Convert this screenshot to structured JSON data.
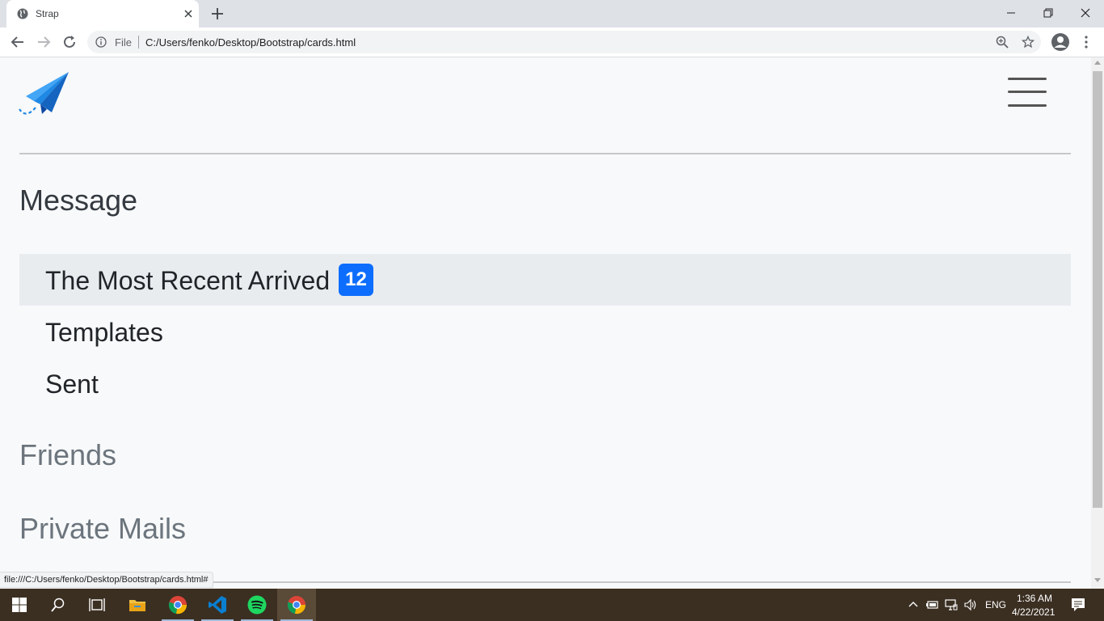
{
  "browser": {
    "tab_title": "Strap",
    "address_scheme": "File",
    "address_url": "C:/Users/fenko/Desktop/Bootstrap/cards.html"
  },
  "page": {
    "headings": {
      "message": "Message",
      "friends": "Friends",
      "private_mails": "Private Mails"
    },
    "message_items": [
      {
        "label": "The Most Recent Arrived",
        "badge": "12",
        "active": true
      },
      {
        "label": "Templates",
        "active": false
      },
      {
        "label": "Sent",
        "active": false
      }
    ],
    "status_url": "file:///C:/Users/fenko/Desktop/Bootstrap/cards.html#"
  },
  "taskbar": {
    "language": "ENG",
    "time": "1:36 AM",
    "date": "4/22/2021"
  },
  "colors": {
    "badge": "#0d6efd",
    "active_item_bg": "#e9ecef",
    "logo": "#1e88e5"
  }
}
